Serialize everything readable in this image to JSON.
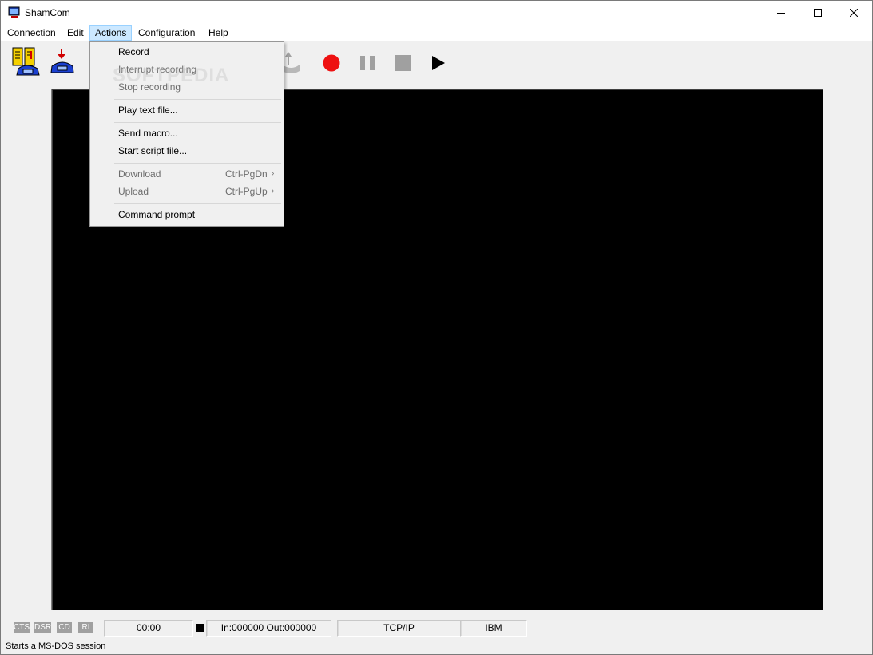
{
  "window": {
    "title": "ShamCom"
  },
  "menubar": {
    "items": [
      {
        "label": "Connection"
      },
      {
        "label": "Edit"
      },
      {
        "label": "Actions"
      },
      {
        "label": "Configuration"
      },
      {
        "label": "Help"
      }
    ],
    "active": "Actions"
  },
  "toolbar": {
    "buttons": [
      "phonebook-icon",
      "hangup-icon",
      "upload-icon",
      "record-icon",
      "pause-icon",
      "stop-icon",
      "play-icon"
    ],
    "colors": {
      "record": "#ee1111",
      "pause": "#a0a0a0",
      "stop": "#a0a0a0",
      "play": "#000000"
    }
  },
  "actions_menu": {
    "items": [
      {
        "label": "Record",
        "enabled": true
      },
      {
        "label": "Interrupt recording",
        "enabled": false
      },
      {
        "label": "Stop recording",
        "enabled": false
      },
      {
        "label": "Play text file...",
        "enabled": true
      },
      {
        "label": "Send macro...",
        "enabled": true
      },
      {
        "label": "Start script file...",
        "enabled": true
      },
      {
        "label": "Download",
        "shortcut": "Ctrl-PgDn",
        "enabled": false,
        "submenu": true
      },
      {
        "label": "Upload",
        "shortcut": "Ctrl-PgUp",
        "enabled": false,
        "submenu": true
      },
      {
        "label": "Command prompt",
        "enabled": true
      }
    ]
  },
  "status": {
    "leds": [
      "CTS",
      "DSR",
      "CD",
      "RI"
    ],
    "timer": "00:00",
    "bytes": "In:000000 Out:000000",
    "protocol": "TCP/IP",
    "emulation": "IBM",
    "message": "Starts a MS-DOS session"
  },
  "watermark": "SOFTPEDIA"
}
